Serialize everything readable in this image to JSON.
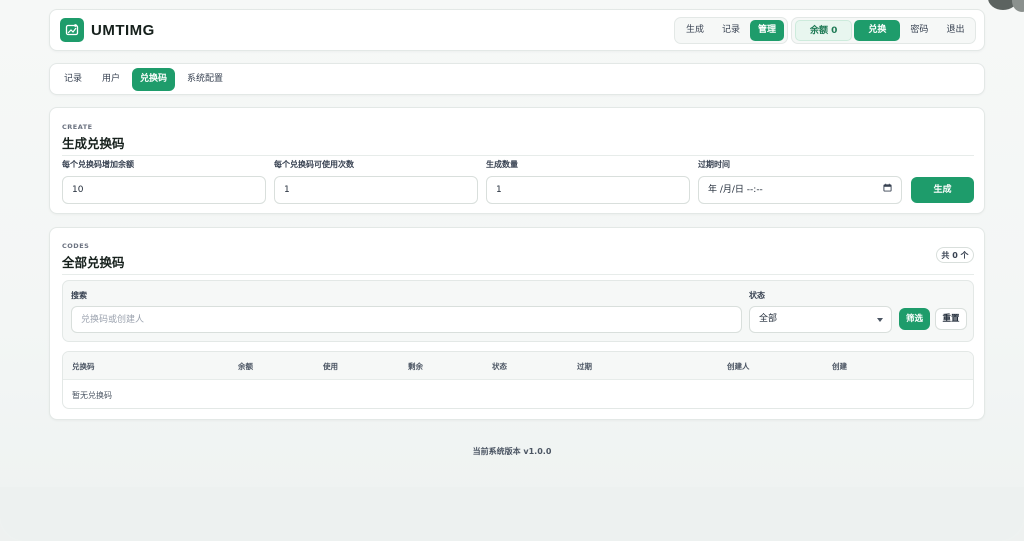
{
  "header": {
    "brand": "UMTIMG",
    "nav": [
      "生成",
      "记录",
      "管理"
    ],
    "active_nav": "管理",
    "balance": "余额 0",
    "actions": [
      "兑换",
      "密码",
      "退出"
    ]
  },
  "tabs": {
    "items": [
      "记录",
      "用户",
      "兑换码",
      "系统配置"
    ],
    "active": "兑换码"
  },
  "create": {
    "eyebrow": "CREATE",
    "title": "生成兑换码",
    "fields": {
      "amount_label": "每个兑换码增加余额",
      "amount_value": "10",
      "uses_label": "每个兑换码可使用次数",
      "uses_value": "1",
      "count_label": "生成数量",
      "count_value": "1",
      "expire_label": "过期时间",
      "expire_placeholder": "年 /月/日 --:--"
    },
    "submit": "生成"
  },
  "codes": {
    "eyebrow": "CODES",
    "title": "全部兑换码",
    "total": "共 0 个",
    "search_label": "搜索",
    "search_placeholder": "兑换码或创建人",
    "status_label": "状态",
    "status_value": "全部",
    "filter_button": "筛选",
    "reset_button": "重置",
    "columns": [
      "兑换码",
      "余额",
      "使用",
      "剩余",
      "状态",
      "过期",
      "创建人",
      "创建"
    ],
    "empty_text": "暂无兑换码"
  },
  "footer": {
    "version_text": "当前系统版本 v1.0.0"
  },
  "colors": {
    "accent": "#1e9c6b",
    "background": "#f3f6f5"
  }
}
